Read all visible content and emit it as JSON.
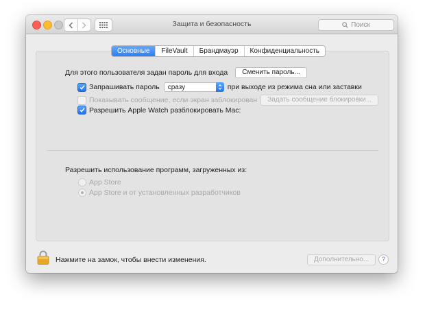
{
  "window": {
    "title": "Защита и безопасность",
    "search_placeholder": "Поиск"
  },
  "tabs": [
    {
      "label": "Основные",
      "active": true
    },
    {
      "label": "FileVault",
      "active": false
    },
    {
      "label": "Брандмауэр",
      "active": false
    },
    {
      "label": "Конфиденциальность",
      "active": false
    }
  ],
  "general": {
    "password_label": "Для этого пользователя задан пароль для входа",
    "change_password_button": "Сменить пароль...",
    "require_password": {
      "label": "Запрашивать пароль",
      "checked": true,
      "selected_option": "сразу",
      "suffix": "при выходе из режима сна или заставки"
    },
    "show_message": {
      "label": "Показывать сообщение, если экран заблокирован",
      "checked": false,
      "button": "Задать сообщение блокировки..."
    },
    "apple_watch": {
      "label": "Разрешить Apple Watch разблокировать Mac:",
      "checked": true
    }
  },
  "allow_apps": {
    "heading": "Разрешить использование программ, загруженных из:",
    "options": [
      {
        "label": "App Store",
        "selected": false
      },
      {
        "label": "App Store и от установленных разработчиков",
        "selected": true
      }
    ]
  },
  "footer": {
    "lock_text": "Нажмите на замок, чтобы внести изменения.",
    "advanced_button": "Дополнительно...",
    "help_label": "?"
  },
  "colors": {
    "accent": "#2d7ef1",
    "close": "#fc5f57",
    "minimize": "#fdbc2e",
    "lock": "#e7a72b"
  }
}
